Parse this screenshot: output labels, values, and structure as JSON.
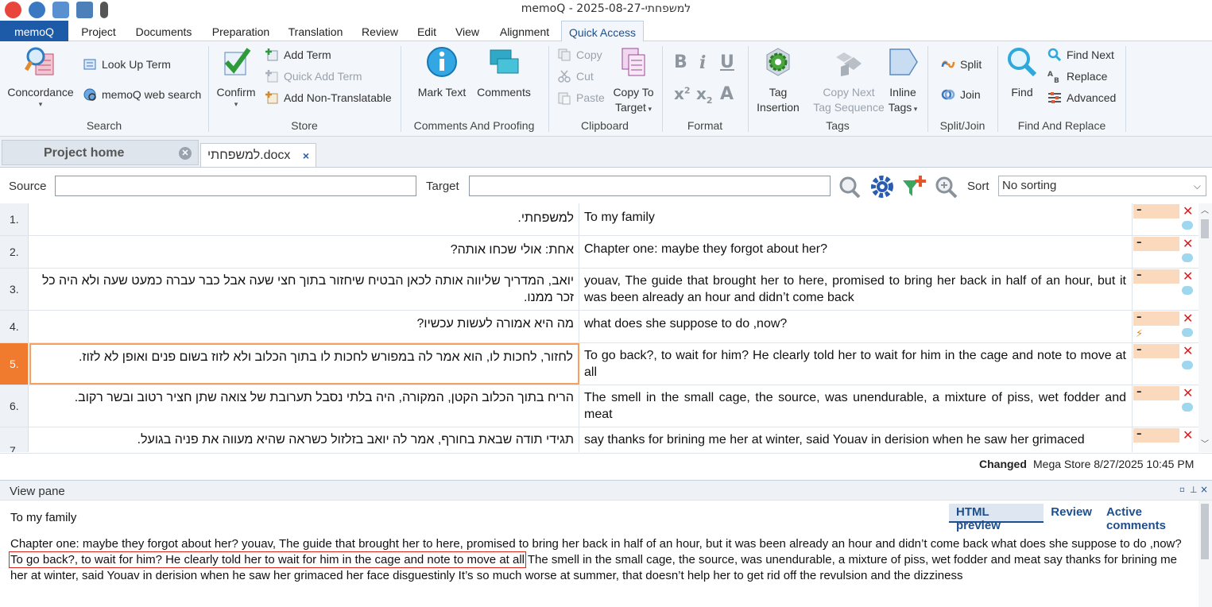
{
  "window": {
    "title": "memoQ - 2025-08-27-למשפחתי"
  },
  "ribbon_tabs": [
    "memoQ",
    "Project",
    "Documents",
    "Preparation",
    "Translation",
    "Review",
    "Edit",
    "View",
    "Alignment",
    "Quick Access"
  ],
  "ribbon": {
    "search": {
      "label": "Search",
      "concordance": "Concordance",
      "look_up_term": "Look Up Term",
      "web_search": "memoQ web search"
    },
    "store": {
      "label": "Store",
      "confirm": "Confirm",
      "add_term": "Add Term",
      "quick_add_term": "Quick Add Term",
      "add_non_translatable": "Add Non-Translatable"
    },
    "comments": {
      "label": "Comments And Proofing",
      "mark_text": "Mark Text",
      "comments": "Comments"
    },
    "clipboard": {
      "label": "Clipboard",
      "copy": "Copy",
      "cut": "Cut",
      "paste": "Paste",
      "copy_to_target_1": "Copy To",
      "copy_to_target_2": "Target"
    },
    "format": {
      "label": "Format"
    },
    "tags": {
      "label": "Tags",
      "tag_insertion_1": "Tag",
      "tag_insertion_2": "Insertion",
      "copy_next_1": "Copy Next",
      "copy_next_2": "Tag Sequence",
      "inline_tags_1": "Inline",
      "inline_tags_2": "Tags"
    },
    "splitjoin": {
      "label": "Split/Join",
      "split": "Split",
      "join": "Join"
    },
    "findreplace": {
      "label": "Find And Replace",
      "find": "Find",
      "find_next": "Find Next",
      "replace": "Replace",
      "advanced": "Advanced"
    }
  },
  "doc_tabs": {
    "project_home": "Project home",
    "document": "למשפחתי.docx"
  },
  "filter": {
    "source_label": "Source",
    "target_label": "Target",
    "sort_label": "Sort",
    "sort_value": "No sorting"
  },
  "rows": [
    {
      "num": "1.",
      "src": "למשפחתי.",
      "tgt": "To my family"
    },
    {
      "num": "2.",
      "src": "אחת: אולי שכחו אותה?",
      "tgt": "Chapter one: maybe they forgot about her?"
    },
    {
      "num": "3.",
      "src": "יואב, המדריך שליווה אותה לכאן הבטיח שיחזור בתוך חצי שעה אבל כבר עברה כמעט שעה ולא היה כל זכר ממנו.",
      "tgt": "youav, The guide that brought her to here, promised to bring her back in half of an hour, but it was been already an hour and didn’t come back"
    },
    {
      "num": "4.",
      "src": "מה היא אמורה לעשות עכשיו?",
      "tgt": "what does she suppose to do ,now?"
    },
    {
      "num": "5.",
      "src": "לחזור, לחכות לו, הוא אמר לה במפורש לחכות לו בתוך הכלוב ולא לזוז בשום פנים ואופן לא לזוז.",
      "tgt": "To go back?, to wait for him? He clearly told her to wait for him in the cage and note to move at all"
    },
    {
      "num": "6.",
      "src": "הריח בתוך הכלוב הקטן, המקורה, היה בלתי נסבל תערובת של צואה שתן חציר רטוב ובשר רקוב.",
      "tgt": "The smell in the small cage, the source, was unendurable, a mixture of piss, wet fodder and meat"
    },
    {
      "num": "7.",
      "src": "תגידי תודה שבאת בחורף, אמר לה יואב בזלזול כשראה שהיא מעווה את פניה בגועל.",
      "tgt": "say thanks for brining me her at winter, said Youav in derision when he saw her grimaced"
    }
  ],
  "row_status": "–",
  "statusbar": {
    "changed": "Changed",
    "info": "Mega Store 8/27/2025 10:45 PM"
  },
  "viewpane": {
    "title": "View pane",
    "tabs": [
      "HTML preview",
      "Review",
      "Active comments"
    ],
    "line1": "To my family",
    "para_a": "Chapter one: maybe they forgot about her? youav, The guide that brought her to here, promised to bring her back in half of an hour, but it was been already an hour and didn’t come back what does she suppose to do ,now? ",
    "para_hl": "To go back?, to wait for him? He clearly told her to wait for him in the cage and note to move at all",
    "para_b": " The smell in the small cage, the source, was unendurable, a mixture of piss, wet fodder and meat say thanks for brining me her at winter, said Youav in derision when he saw her grimaced her face disguestinly  It’s so much worse at summer, that doesn’t help her to get rid off the revulsion and the dizziness"
  },
  "colors": {
    "accent": "#1d5aa8",
    "active_row": "#f07a2e",
    "status_bar": "#fbd9bd",
    "reject": "#e01a1a"
  }
}
